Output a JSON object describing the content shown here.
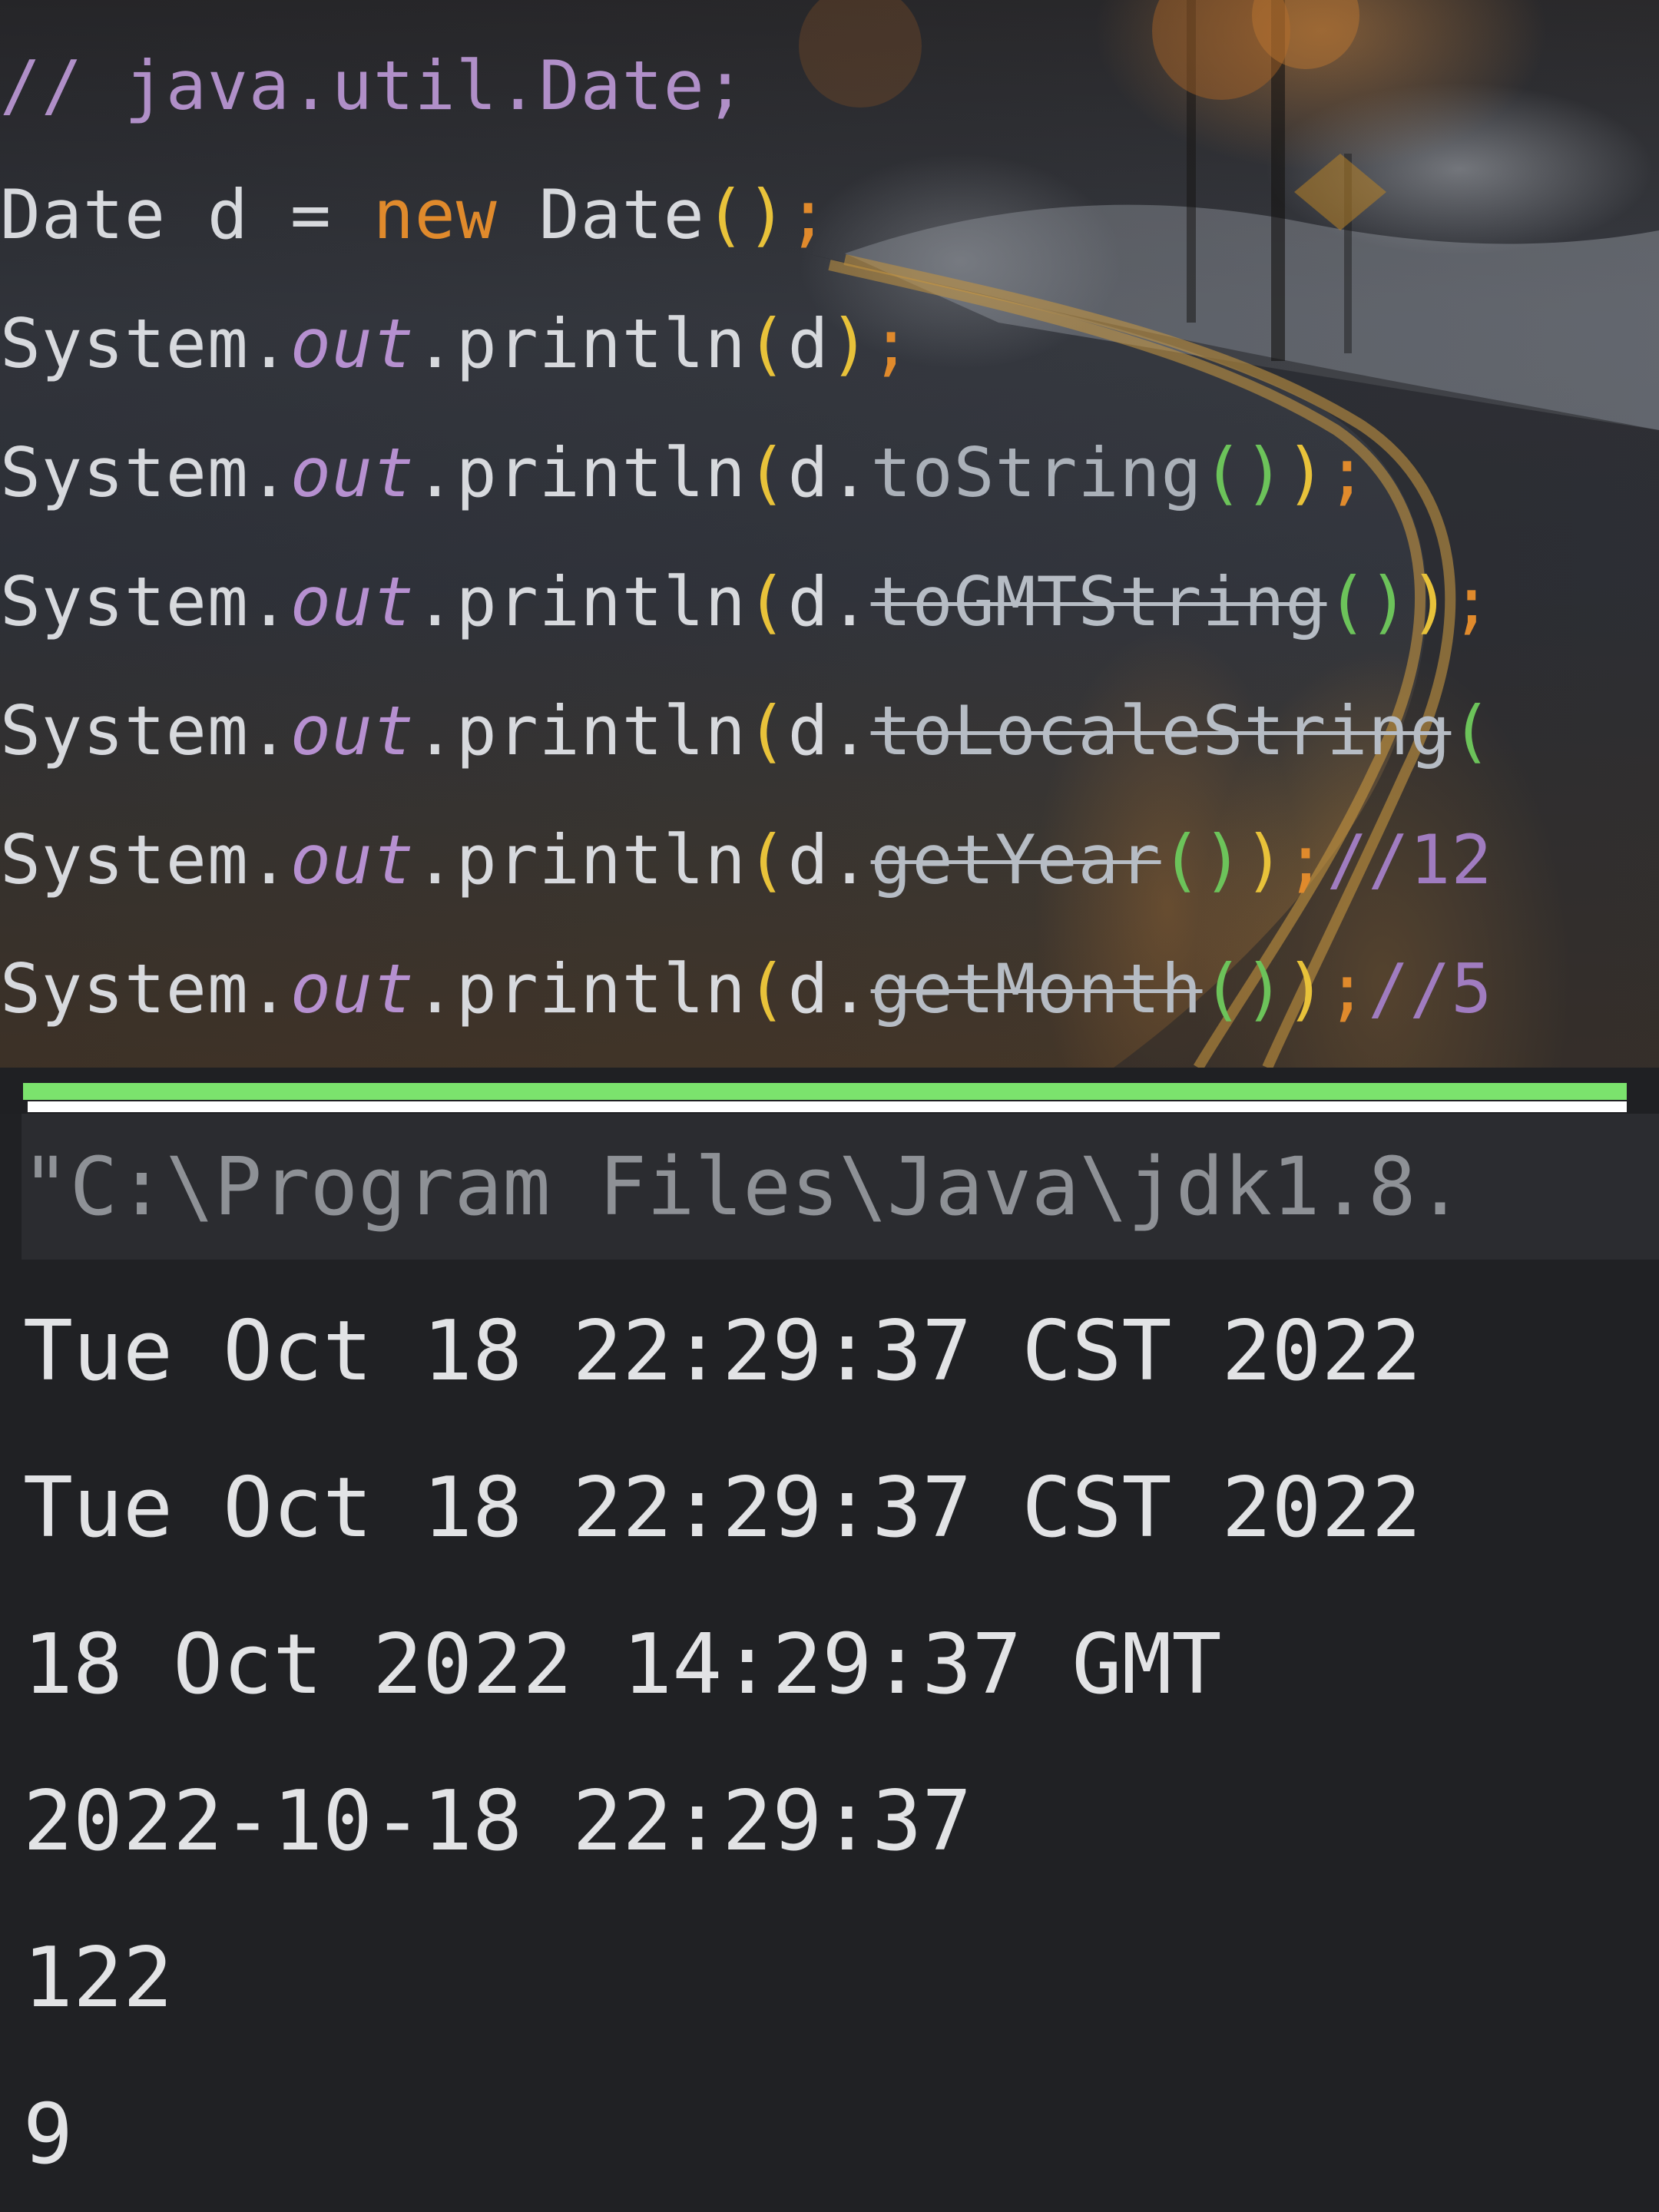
{
  "editor": {
    "background": "snowy-road-wallpaper",
    "lines": [
      {
        "tokens": [
          {
            "text": "// java.util.Date;",
            "kind": "comment"
          }
        ]
      },
      {
        "tokens": [
          {
            "text": "Date d = ",
            "kind": "plain"
          },
          {
            "text": "new",
            "kind": "kw"
          },
          {
            "text": " Date",
            "kind": "plain"
          },
          {
            "text": "()",
            "kind": "p1"
          },
          {
            "text": ";",
            "kind": "semi"
          }
        ]
      },
      {
        "tokens": [
          {
            "text": "System.",
            "kind": "plain"
          },
          {
            "text": "out",
            "kind": "static"
          },
          {
            "text": ".println",
            "kind": "plain"
          },
          {
            "text": "(",
            "kind": "p1"
          },
          {
            "text": "d",
            "kind": "plain"
          },
          {
            "text": ")",
            "kind": "p1"
          },
          {
            "text": ";",
            "kind": "semi"
          }
        ]
      },
      {
        "tokens": [
          {
            "text": "System.",
            "kind": "plain"
          },
          {
            "text": "out",
            "kind": "static"
          },
          {
            "text": ".println",
            "kind": "plain"
          },
          {
            "text": "(",
            "kind": "p1"
          },
          {
            "text": "d.",
            "kind": "plain"
          },
          {
            "text": "toString",
            "kind": "method"
          },
          {
            "text": "()",
            "kind": "p2"
          },
          {
            "text": ")",
            "kind": "p1"
          },
          {
            "text": ";",
            "kind": "semi"
          }
        ]
      },
      {
        "tokens": [
          {
            "text": "System.",
            "kind": "plain"
          },
          {
            "text": "out",
            "kind": "static"
          },
          {
            "text": ".println",
            "kind": "plain"
          },
          {
            "text": "(",
            "kind": "p1"
          },
          {
            "text": "d.",
            "kind": "plain"
          },
          {
            "text": "toGMTString",
            "kind": "depr"
          },
          {
            "text": "()",
            "kind": "p2"
          },
          {
            "text": ")",
            "kind": "p1"
          },
          {
            "text": ";",
            "kind": "semi"
          }
        ]
      },
      {
        "tokens": [
          {
            "text": "System.",
            "kind": "plain"
          },
          {
            "text": "out",
            "kind": "static"
          },
          {
            "text": ".println",
            "kind": "plain"
          },
          {
            "text": "(",
            "kind": "p1"
          },
          {
            "text": "d.",
            "kind": "plain"
          },
          {
            "text": "toLocaleString",
            "kind": "depr"
          },
          {
            "text": "(",
            "kind": "p2"
          }
        ]
      },
      {
        "tokens": [
          {
            "text": "System.",
            "kind": "plain"
          },
          {
            "text": "out",
            "kind": "static"
          },
          {
            "text": ".println",
            "kind": "plain"
          },
          {
            "text": "(",
            "kind": "p1"
          },
          {
            "text": "d.",
            "kind": "plain"
          },
          {
            "text": "getYear",
            "kind": "depr"
          },
          {
            "text": "()",
            "kind": "p2"
          },
          {
            "text": ")",
            "kind": "p1"
          },
          {
            "text": ";",
            "kind": "semi"
          },
          {
            "text": "//12",
            "kind": "inline-comment"
          }
        ]
      },
      {
        "tokens": [
          {
            "text": "System.",
            "kind": "plain"
          },
          {
            "text": "out",
            "kind": "static"
          },
          {
            "text": ".println",
            "kind": "plain"
          },
          {
            "text": "(",
            "kind": "p1"
          },
          {
            "text": "d.",
            "kind": "plain"
          },
          {
            "text": "getMonth",
            "kind": "depr"
          },
          {
            "text": "()",
            "kind": "p2"
          },
          {
            "text": ")",
            "kind": "p1"
          },
          {
            "text": ";",
            "kind": "semi"
          },
          {
            "text": "//5",
            "kind": "inline-comment"
          }
        ]
      }
    ]
  },
  "separator": {
    "colors": [
      "#7be36d",
      "#ffffff"
    ]
  },
  "console": {
    "command": "\"C:\\Program Files\\Java\\jdk1.8.",
    "output": [
      "Tue Oct 18 22:29:37 CST 2022",
      "Tue Oct 18 22:29:37 CST 2022",
      "18 Oct 2022 14:29:37 GMT",
      "2022-10-18 22:29:37",
      "122",
      "9"
    ]
  }
}
